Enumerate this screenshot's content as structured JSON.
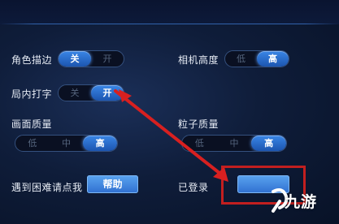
{
  "settings": {
    "role_outline": {
      "label": "角色描边",
      "off": "关",
      "on": "开",
      "selected": "off"
    },
    "camera_height": {
      "label": "相机高度",
      "low": "低",
      "high": "高",
      "selected": "high"
    },
    "in_game_chat": {
      "label": "局内打字",
      "off": "关",
      "on": "开",
      "selected": "on"
    },
    "image_quality": {
      "label": "画面质量",
      "low": "低",
      "mid": "中",
      "high": "高",
      "selected": "high"
    },
    "particle_quality": {
      "label": "粒子质量",
      "low": "低",
      "mid": "中",
      "high": "高",
      "selected": "high"
    },
    "help": {
      "label": "遇到困难请点我",
      "button": "帮助"
    },
    "logged_in": {
      "label": "已登录"
    }
  },
  "watermark": {
    "text": "九游"
  },
  "annotation": {
    "color": "#c21f1f"
  }
}
